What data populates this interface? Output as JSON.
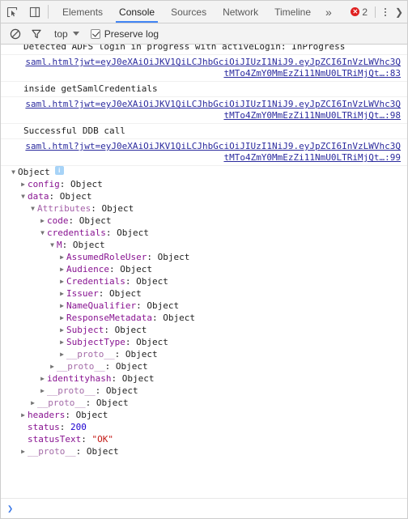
{
  "tabbar": {
    "inspect_icon": "inspect-element-icon",
    "device_icon": "device-toolbar-icon",
    "tabs": [
      {
        "label": "Elements",
        "active": false
      },
      {
        "label": "Console",
        "active": true
      },
      {
        "label": "Sources",
        "active": false
      },
      {
        "label": "Network",
        "active": false
      },
      {
        "label": "Timeline",
        "active": false
      }
    ],
    "more_label": "»",
    "error_count": "2",
    "error_glyph": "✕",
    "kebab_icon": "more-options-icon",
    "chevron_icon": "chevron-right-icon"
  },
  "filterbar": {
    "clear_icon": "clear-console-icon",
    "filter_icon": "filter-funnel-icon",
    "context": "top",
    "preserve_log_label": "Preserve log",
    "preserve_log_checked": true
  },
  "console": {
    "messages": [
      {
        "text": "Detected ADFS login in progress with activeLogin: InProgress",
        "link": "",
        "link_line": ""
      },
      {
        "text": "",
        "link": "saml.html?jwt=eyJ0eXAiOiJKV1QiLCJhbGciOiJIUzI1NiJ9.eyJpZCI6InVzLWVhc3QtMTo4ZmY0MmEzZi11NmU0LTRiMjQt…",
        "link_line": ":83"
      },
      {
        "text": "inside getSamlCredentials",
        "link": "",
        "link_line": ""
      },
      {
        "text": "",
        "link": "saml.html?jwt=eyJ0eXAiOiJKV1QiLCJhbGciOiJIUzI1NiJ9.eyJpZCI6InVzLWVhc3QtMTo4ZmY0MmEzZi11NmU0LTRiMjQt…",
        "link_line": ":98"
      },
      {
        "text": "Successful DDB call",
        "link": "",
        "link_line": ""
      },
      {
        "text": "",
        "link": "saml.html?jwt=eyJ0eXAiOiJKV1QiLCJhbGciOiJIUzI1NiJ9.eyJpZCI6InVzLWVhc3QtMTo4ZmY0MmEzZi11NmU0LTRiMjQt…",
        "link_line": ":99"
      }
    ],
    "object_tree": {
      "root": {
        "label": "Object",
        "triangle": "▼",
        "badge": "i"
      },
      "rows": [
        {
          "depth": 1,
          "tri": "▶",
          "key": "config",
          "sep": ": ",
          "value": "Object",
          "vtype": "obj",
          "kstyle": "key"
        },
        {
          "depth": 1,
          "tri": "▼",
          "key": "data",
          "sep": ": ",
          "value": "Object",
          "vtype": "obj",
          "kstyle": "key"
        },
        {
          "depth": 2,
          "tri": "▼",
          "key": "Attributes",
          "sep": ": ",
          "value": "Object",
          "vtype": "obj",
          "kstyle": "key dim"
        },
        {
          "depth": 3,
          "tri": "▶",
          "key": "code",
          "sep": ": ",
          "value": "Object",
          "vtype": "obj",
          "kstyle": "key"
        },
        {
          "depth": 3,
          "tri": "▼",
          "key": "credentials",
          "sep": ": ",
          "value": "Object",
          "vtype": "obj",
          "kstyle": "key"
        },
        {
          "depth": 4,
          "tri": "▼",
          "key": "M",
          "sep": ": ",
          "value": "Object",
          "vtype": "obj",
          "kstyle": "key"
        },
        {
          "depth": 5,
          "tri": "▶",
          "key": "AssumedRoleUser",
          "sep": ": ",
          "value": "Object",
          "vtype": "obj",
          "kstyle": "key"
        },
        {
          "depth": 5,
          "tri": "▶",
          "key": "Audience",
          "sep": ": ",
          "value": "Object",
          "vtype": "obj",
          "kstyle": "key"
        },
        {
          "depth": 5,
          "tri": "▶",
          "key": "Credentials",
          "sep": ": ",
          "value": "Object",
          "vtype": "obj",
          "kstyle": "key"
        },
        {
          "depth": 5,
          "tri": "▶",
          "key": "Issuer",
          "sep": ": ",
          "value": "Object",
          "vtype": "obj",
          "kstyle": "key"
        },
        {
          "depth": 5,
          "tri": "▶",
          "key": "NameQualifier",
          "sep": ": ",
          "value": "Object",
          "vtype": "obj",
          "kstyle": "key"
        },
        {
          "depth": 5,
          "tri": "▶",
          "key": "ResponseMetadata",
          "sep": ": ",
          "value": "Object",
          "vtype": "obj",
          "kstyle": "key"
        },
        {
          "depth": 5,
          "tri": "▶",
          "key": "Subject",
          "sep": ": ",
          "value": "Object",
          "vtype": "obj",
          "kstyle": "key"
        },
        {
          "depth": 5,
          "tri": "▶",
          "key": "SubjectType",
          "sep": ": ",
          "value": "Object",
          "vtype": "obj",
          "kstyle": "key"
        },
        {
          "depth": 5,
          "tri": "▶",
          "key": "__proto__",
          "sep": ": ",
          "value": "Object",
          "vtype": "obj",
          "kstyle": "key proto"
        },
        {
          "depth": 4,
          "tri": "▶",
          "key": "__proto__",
          "sep": ": ",
          "value": "Object",
          "vtype": "obj",
          "kstyle": "key proto"
        },
        {
          "depth": 3,
          "tri": "▶",
          "key": "identityhash",
          "sep": ": ",
          "value": "Object",
          "vtype": "obj",
          "kstyle": "key"
        },
        {
          "depth": 3,
          "tri": "▶",
          "key": "__proto__",
          "sep": ": ",
          "value": "Object",
          "vtype": "obj",
          "kstyle": "key proto"
        },
        {
          "depth": 2,
          "tri": "▶",
          "key": "__proto__",
          "sep": ": ",
          "value": "Object",
          "vtype": "obj",
          "kstyle": "key proto"
        },
        {
          "depth": 1,
          "tri": "▶",
          "key": "headers",
          "sep": ": ",
          "value": "Object",
          "vtype": "obj",
          "kstyle": "key"
        },
        {
          "depth": 1,
          "tri": "",
          "key": "status",
          "sep": ": ",
          "value": "200",
          "vtype": "num",
          "kstyle": "key"
        },
        {
          "depth": 1,
          "tri": "",
          "key": "statusText",
          "sep": ": ",
          "value": "\"OK\"",
          "vtype": "str",
          "kstyle": "key"
        },
        {
          "depth": 1,
          "tri": "▶",
          "key": "__proto__",
          "sep": ": ",
          "value": "Object",
          "vtype": "obj",
          "kstyle": "key proto"
        }
      ]
    }
  },
  "prompt": {
    "arrow": "❯",
    "value": "",
    "placeholder": ""
  }
}
